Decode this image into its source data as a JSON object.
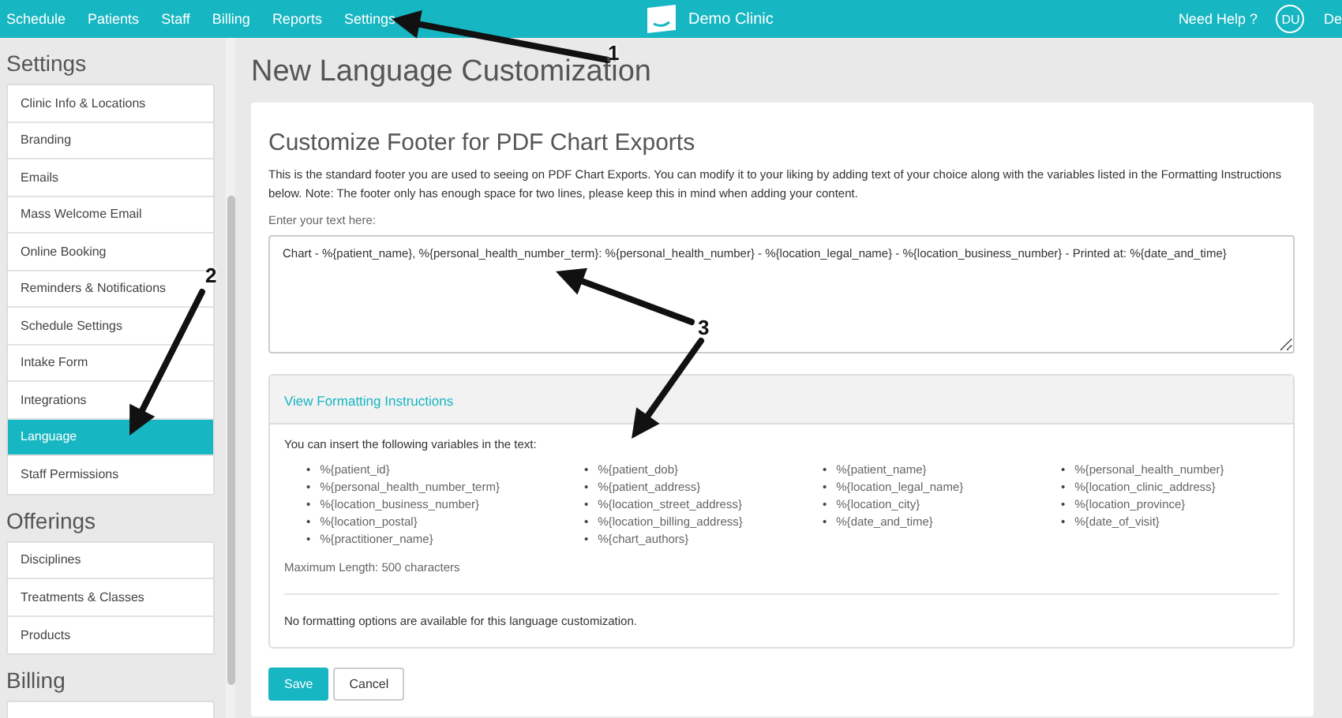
{
  "top_nav": {
    "items": [
      {
        "label": "Schedule",
        "selected": false
      },
      {
        "label": "Patients",
        "selected": false
      },
      {
        "label": "Staff",
        "selected": false
      },
      {
        "label": "Billing",
        "selected": false
      },
      {
        "label": "Reports",
        "selected": false
      },
      {
        "label": "Settings",
        "selected": false
      }
    ],
    "clinic_name": "Demo Clinic",
    "help": "Need Help ?",
    "user_initials": "DU",
    "user_name": "De"
  },
  "sidebar": {
    "groups": [
      {
        "title": "Settings",
        "items": [
          {
            "label": "Clinic Info & Locations",
            "selected": false
          },
          {
            "label": "Branding",
            "selected": false
          },
          {
            "label": "Emails",
            "selected": false
          },
          {
            "label": "Mass Welcome Email",
            "selected": false
          },
          {
            "label": "Online Booking",
            "selected": false
          },
          {
            "label": "Reminders & Notifications",
            "selected": false
          },
          {
            "label": "Schedule Settings",
            "selected": false
          },
          {
            "label": "Intake Form",
            "selected": false
          },
          {
            "label": "Integrations",
            "selected": false
          },
          {
            "label": "Language",
            "selected": true
          },
          {
            "label": "Staff Permissions",
            "selected": false
          }
        ]
      },
      {
        "title": "Offerings",
        "items": [
          {
            "label": "Disciplines",
            "selected": false
          },
          {
            "label": "Treatments & Classes",
            "selected": false
          },
          {
            "label": "Products",
            "selected": false
          }
        ]
      },
      {
        "title": "Billing"
      }
    ]
  },
  "page_title": "New Language Customization",
  "card": {
    "title": "Customize Footer for PDF Chart Exports",
    "description": "This is the standard footer you are used to seeing on PDF Chart Exports. You can modify it to your liking by adding text of your choice along with the variables listed in the Formatting Instructions below. Note: The footer only has enough space for two lines, please keep this in mind when adding your content.",
    "field_label": "Enter your text here:",
    "field_value": "Chart - %{patient_name}, %{personal_health_number_term}: %{personal_health_number} - %{location_legal_name} - %{location_business_number} - Printed at: %{date_and_time}",
    "instructions": {
      "toggle": "View Formatting Instructions",
      "intro": "You can insert the following variables in the text:",
      "bullet": "•",
      "columns": [
        [
          "%{patient_id}",
          "%{personal_health_number_term}",
          "%{location_business_number}",
          "%{location_postal}",
          "%{practitioner_name}"
        ],
        [
          "%{patient_dob}",
          "%{patient_address}",
          "%{location_street_address}",
          "%{location_billing_address}",
          "%{chart_authors}"
        ],
        [
          "%{patient_name}",
          "%{location_legal_name}",
          "%{location_city}",
          "%{date_and_time}"
        ],
        [
          "%{personal_health_number}",
          "%{location_clinic_address}",
          "%{location_province}",
          "%{date_of_visit}"
        ]
      ],
      "max_length": "Maximum Length: 500 characters",
      "note": "No formatting options are available for this language customization."
    },
    "buttons": [
      {
        "label": "Save",
        "kind": "primary"
      },
      {
        "label": "Cancel",
        "kind": "secondary"
      }
    ]
  },
  "annotations": [
    "1",
    "2",
    "3"
  ]
}
